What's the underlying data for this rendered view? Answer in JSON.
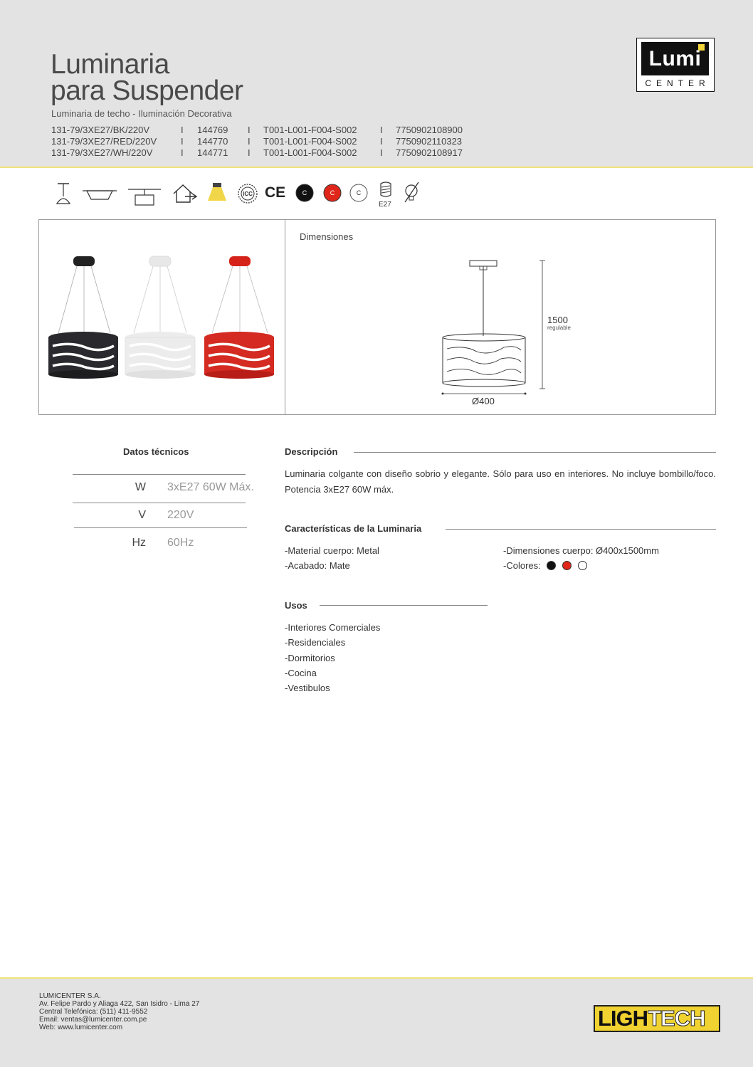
{
  "header": {
    "title_line1": "Luminaria",
    "title_line2": "para Suspender",
    "subtitle": "Luminaria de techo - Iluminación Decorativa",
    "separator": "I",
    "codes": [
      {
        "model": "131-79/3XE27/BK/220V",
        "code": "144769",
        "ref": "T001-L001-F004-S002",
        "ean": "7750902108900"
      },
      {
        "model": "131-79/3XE27/RED/220V",
        "code": "144770",
        "ref": "T001-L001-F004-S002",
        "ean": "7750902110323"
      },
      {
        "model": "131-79/3XE27/WH/220V",
        "code": "144771",
        "ref": "T001-L001-F004-S002",
        "ean": "7750902108917"
      }
    ],
    "logo": {
      "top": "Lumi",
      "bottom": "CENTER"
    }
  },
  "icons": {
    "pendant": "pendant-lamp-icon",
    "ceiling": "ceiling-mount-icon",
    "surface": "surface-box-icon",
    "indoor": "indoor-house-icon",
    "light": "light-beam-icon",
    "icc": "icc-seal-icon",
    "ce": "CE",
    "color_letter": "C",
    "colors": [
      "#111111",
      "#e0261b",
      "#ffffff"
    ],
    "bulb_label": "E27",
    "no_dimmer": "no-dimmer-icon"
  },
  "dimensions": {
    "label": "Dimensiones",
    "height": "1500",
    "height_note": "regulable",
    "diameter": "Ø400"
  },
  "tech": {
    "title": "Datos técnicos",
    "rows": [
      {
        "key": "W",
        "value": "3xE27 60W Máx."
      },
      {
        "key": "V",
        "value": "220V"
      },
      {
        "key": "Hz",
        "value": "60Hz"
      }
    ]
  },
  "description": {
    "title": "Descripción",
    "text": "Luminaria colgante con diseño sobrio y elegante. Sólo para uso en interiores. No incluye bombillo/foco. Potencia 3xE27 60W máx."
  },
  "features": {
    "title": "Características de la Luminaria",
    "left": [
      "-Material cuerpo: Metal",
      "-Acabado: Mate"
    ],
    "right": [
      "-Dimensiones cuerpo: Ø400x1500mm",
      "-Colores:"
    ],
    "swatches": [
      "#111111",
      "#e0261b",
      "#ffffff"
    ]
  },
  "usos": {
    "title": "Usos",
    "items": [
      "-Interiores Comerciales",
      "-Residenciales",
      "-Dormitorios",
      "-Cocina",
      "-Vestibulos"
    ]
  },
  "footer": {
    "lines": [
      "LUMICENTER S.A.",
      "Av. Felipe Pardo y Aliaga 422, San Isidro - Lima 27",
      "Central Telefónica: (511) 411-9552",
      "Email: ventas@lumicenter.com.pe",
      "Web: www.lumicenter.com"
    ],
    "brand_part1": "LIGH",
    "brand_part2": "TECH"
  }
}
